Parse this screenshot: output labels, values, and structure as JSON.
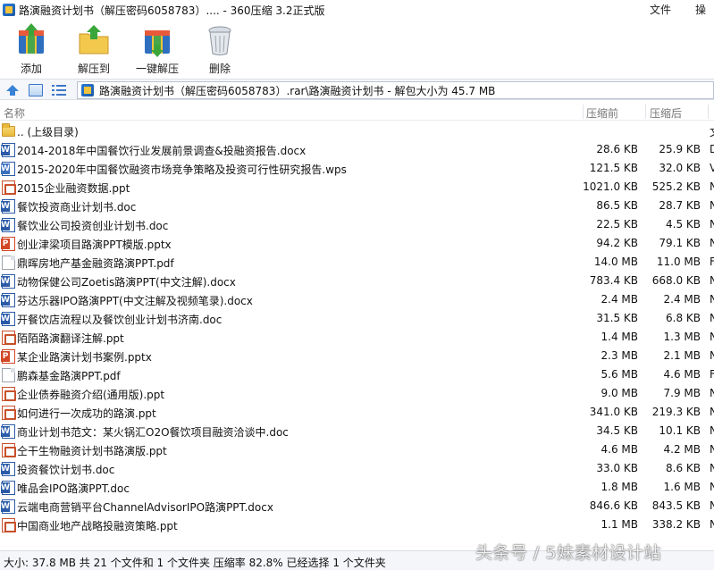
{
  "window": {
    "title": "路演融资计划书（解压密码6058783）.... - 360压缩 3.2正式版",
    "menu": [
      "文件",
      "操作"
    ]
  },
  "toolbar": {
    "buttons": [
      {
        "label": "添加",
        "icon": "add-archive-icon"
      },
      {
        "label": "解压到",
        "icon": "extract-to-icon"
      },
      {
        "label": "一键解压",
        "icon": "one-click-extract-icon"
      },
      {
        "label": "删除",
        "icon": "trash-icon"
      }
    ]
  },
  "address": {
    "path": "路演融资计划书（解压密码6058783）.rar\\路演融资计划书 - 解包大小为 45.7 MB"
  },
  "columns": {
    "name": "名称",
    "size": "压缩前",
    "compressed": "压缩后"
  },
  "parent": {
    "label": ".. (上级目录)",
    "trail": "文"
  },
  "files": [
    {
      "name": "2014-2018年中国餐饮行业发展前景调查&投融资报告.docx",
      "size": "28.6 KB",
      "compressed": "25.9 KB",
      "type": "doc",
      "trail": "D"
    },
    {
      "name": "2015-2020年中国餐饮融资市场竞争策略及投资可行性研究报告.wps",
      "size": "121.5 KB",
      "compressed": "32.0 KB",
      "type": "wps",
      "trail": "V"
    },
    {
      "name": "2015企业融资数据.ppt",
      "size": "1021.0 KB",
      "compressed": "525.2 KB",
      "type": "ppt",
      "trail": "N"
    },
    {
      "name": "餐饮投资商业计划书.doc",
      "size": "86.5 KB",
      "compressed": "28.7 KB",
      "type": "doc",
      "trail": "N"
    },
    {
      "name": "餐饮业公司投资创业计划书.doc",
      "size": "22.5 KB",
      "compressed": "4.5 KB",
      "type": "doc",
      "trail": "N"
    },
    {
      "name": "创业津梁项目路演PPT模版.pptx",
      "size": "94.2 KB",
      "compressed": "79.1 KB",
      "type": "pptx",
      "trail": "N"
    },
    {
      "name": "鼎晖房地产基金融资路演PPT.pdf",
      "size": "14.0 MB",
      "compressed": "11.0 MB",
      "type": "pdf",
      "trail": "F"
    },
    {
      "name": "动物保健公司Zoetis路演PPT(中文注解).docx",
      "size": "783.4 KB",
      "compressed": "668.0 KB",
      "type": "doc",
      "trail": "N"
    },
    {
      "name": "芬达乐器IPO路演PPT(中文注解及视频笔录).docx",
      "size": "2.4 MB",
      "compressed": "2.4 MB",
      "type": "doc",
      "trail": "N"
    },
    {
      "name": "开餐饮店流程以及餐饮创业计划书济南.doc",
      "size": "31.5 KB",
      "compressed": "6.8 KB",
      "type": "doc",
      "trail": "N"
    },
    {
      "name": "陌陌路演翻译注解.ppt",
      "size": "1.4 MB",
      "compressed": "1.3 MB",
      "type": "ppt",
      "trail": "N"
    },
    {
      "name": "某企业路演计划书案例.pptx",
      "size": "2.3 MB",
      "compressed": "2.1 MB",
      "type": "pptx",
      "trail": "N"
    },
    {
      "name": "鹏森基金路演PPT.pdf",
      "size": "5.6 MB",
      "compressed": "4.6 MB",
      "type": "pdf",
      "trail": "F"
    },
    {
      "name": "企业债券融资介绍(通用版).ppt",
      "size": "9.0 MB",
      "compressed": "7.9 MB",
      "type": "ppt",
      "trail": "N"
    },
    {
      "name": "如何进行一次成功的路演.ppt",
      "size": "341.0 KB",
      "compressed": "219.3 KB",
      "type": "ppt",
      "trail": "N"
    },
    {
      "name": "商业计划书范文：某火锅汇O2O餐饮项目融资洽谈中.doc",
      "size": "34.5 KB",
      "compressed": "10.1 KB",
      "type": "doc",
      "trail": "N"
    },
    {
      "name": "仝干生物融资计划书路演版.ppt",
      "size": "4.6 MB",
      "compressed": "4.2 MB",
      "type": "ppt",
      "trail": "N"
    },
    {
      "name": "投资餐饮计划书.doc",
      "size": "33.0 KB",
      "compressed": "8.6 KB",
      "type": "doc",
      "trail": "N"
    },
    {
      "name": "唯品会IPO路演PPT.doc",
      "size": "1.8 MB",
      "compressed": "1.6 MB",
      "type": "doc",
      "trail": "N"
    },
    {
      "name": "云端电商营销平台ChannelAdvisorIPO路演PPT.docx",
      "size": "846.6 KB",
      "compressed": "843.5 KB",
      "type": "doc",
      "trail": "N"
    },
    {
      "name": "中国商业地产战略投融资策略.ppt",
      "size": "1.1 MB",
      "compressed": "338.2 KB",
      "type": "ppt",
      "trail": "N"
    }
  ],
  "status": {
    "text": "大小: 37.8 MB 共 21 个文件和 1 个文件夹 压缩率 82.8% 已经选择 1 个文件夹"
  },
  "watermark": "头条号 / 5妹素材设计站"
}
